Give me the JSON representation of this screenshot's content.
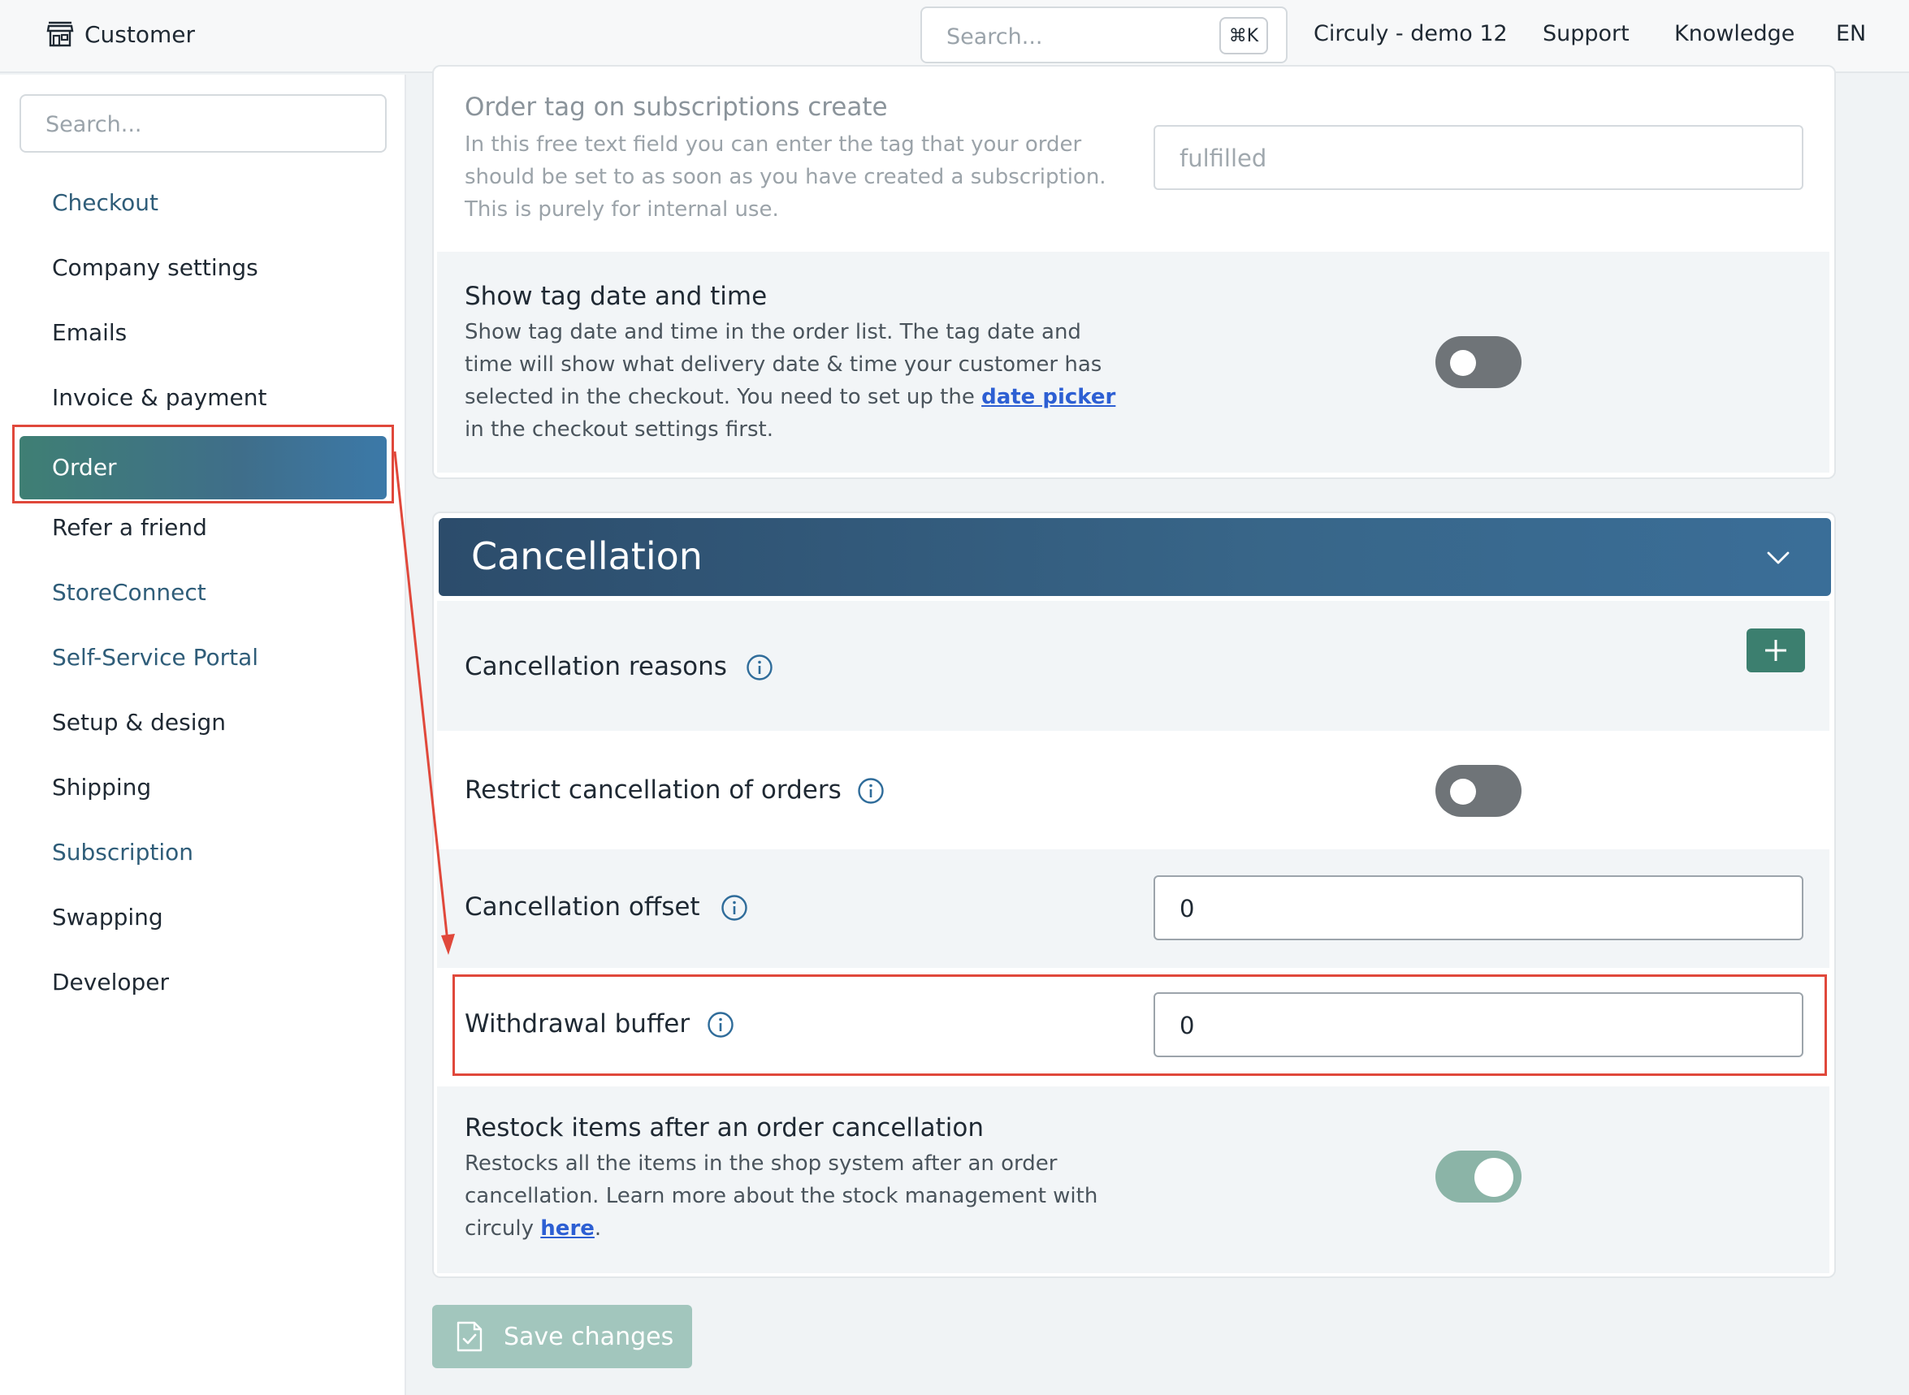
{
  "header": {
    "app_title": "Customer",
    "search_placeholder": "Search...",
    "search_shortcut": "⌘K",
    "account": "Circuly - demo 12",
    "support": "Support",
    "knowledge": "Knowledge",
    "language": "EN"
  },
  "sidebar": {
    "search_placeholder": "Search...",
    "items": [
      {
        "label": "Checkout"
      },
      {
        "label": "Company settings"
      },
      {
        "label": "Emails"
      },
      {
        "label": "Invoice & payment"
      },
      {
        "label": "Order"
      },
      {
        "label": "Refer a friend"
      },
      {
        "label": "StoreConnect"
      },
      {
        "label": "Self-Service Portal"
      },
      {
        "label": "Setup & design"
      },
      {
        "label": "Shipping"
      },
      {
        "label": "Subscription"
      },
      {
        "label": "Swapping"
      },
      {
        "label": "Developer"
      }
    ],
    "active_item": "Order"
  },
  "order_settings": {
    "tag_on_create": {
      "title": "Order tag on subscriptions create",
      "description": "In this free text field you can enter the tag that your order should be set to as soon as you have created a subscription. This is purely for internal use.",
      "placeholder": "fulfilled"
    },
    "show_tag_date": {
      "title": "Show tag date and time",
      "description_before": "Show tag date and time in the order list. The tag date and time will show what delivery date & time your customer has selected in the checkout. You need to set up the ",
      "link": "date picker",
      "description_after": " in the checkout settings first.",
      "enabled": false
    }
  },
  "cancellation": {
    "section_title": "Cancellation",
    "reasons": {
      "title": "Cancellation reasons"
    },
    "restrict": {
      "title": "Restrict cancellation of orders",
      "enabled": false
    },
    "offset": {
      "title": "Cancellation offset",
      "value": "0"
    },
    "withdrawal_buffer": {
      "title": "Withdrawal buffer",
      "value": "0"
    },
    "restock": {
      "title": "Restock items after an order cancellation",
      "description_before": "Restocks all the items in the shop system after an order cancellation. Learn more about the stock management with circuly ",
      "link": "here",
      "description_after": ".",
      "enabled": true
    }
  },
  "footer": {
    "save_label": "Save changes"
  },
  "colors": {
    "accent_green": "#3c7f6f",
    "header_blue": "#2c4c6b",
    "highlight_red": "#e0483b",
    "link_blue": "#2d5fd3"
  }
}
